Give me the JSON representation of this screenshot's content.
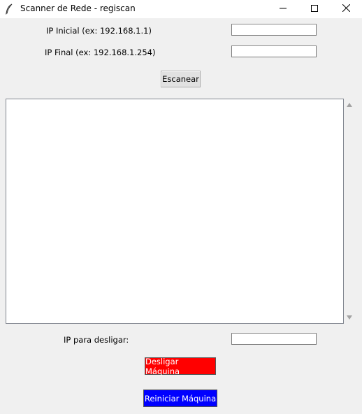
{
  "window": {
    "title": "Scanner de Rede - regiscan",
    "icon": "feather-icon",
    "controls": [
      "minimize-icon",
      "maximize-icon",
      "close-icon"
    ]
  },
  "form": {
    "ip_start_label": "IP Inicial (ex: 192.168.1.1)",
    "ip_start_value": "",
    "ip_end_label": "IP Final (ex: 192.168.1.254)",
    "ip_end_value": "",
    "scan_button": "Escanear"
  },
  "output": {
    "text": ""
  },
  "shutdown": {
    "ip_label": "IP para desligar:",
    "ip_value": "",
    "shutdown_button": "Desligar Máquina",
    "shutdown_color": "#ff0000",
    "restart_button": "Reiniciar Máquina",
    "restart_color": "#0000ff"
  }
}
